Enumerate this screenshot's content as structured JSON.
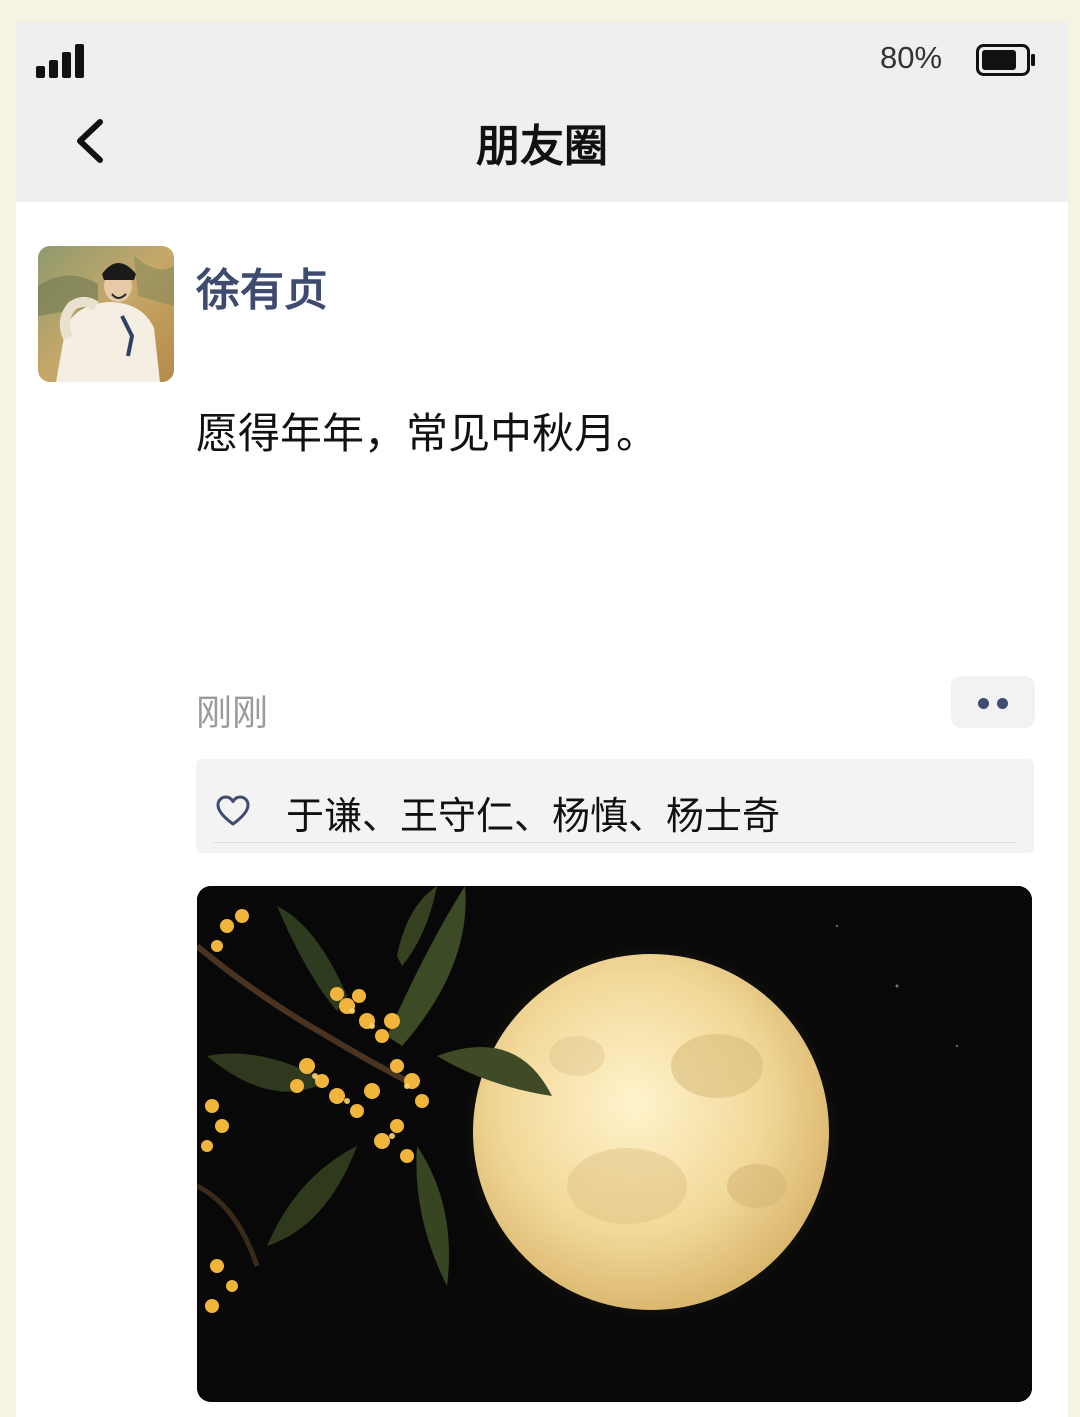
{
  "status_bar": {
    "battery_percent": "80%",
    "battery_level": 0.8
  },
  "header": {
    "title": "朋友圈"
  },
  "post": {
    "author": "徐有贞",
    "text": "愿得年年，常见中秋月。",
    "time": "刚刚",
    "likes": "于谦、王守仁、杨慎、杨士奇"
  },
  "colors": {
    "name_link": "#3e4a6e",
    "header_bg": "#efefef",
    "page_bg": "#f6f2e4"
  }
}
